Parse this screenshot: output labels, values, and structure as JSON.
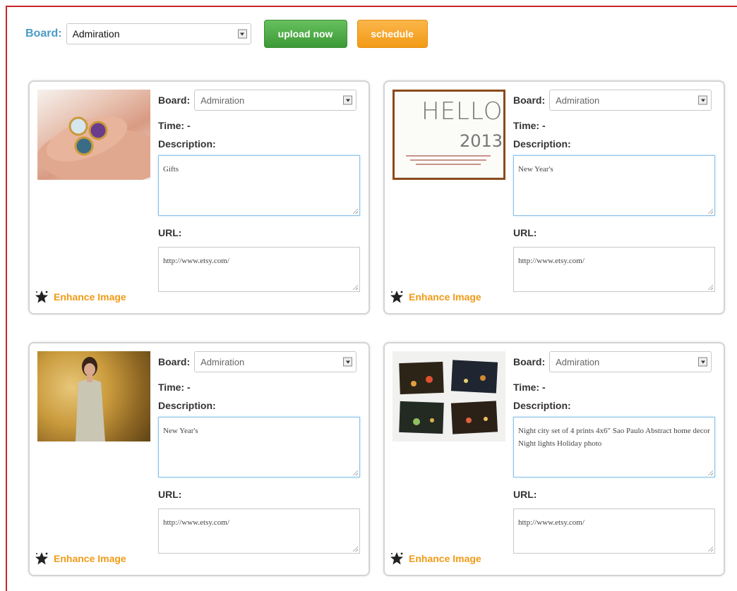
{
  "toolbar": {
    "board_label": "Board:",
    "board_value": "Admiration",
    "upload_label": "upload now",
    "schedule_label": "schedule"
  },
  "labels": {
    "board": "Board:",
    "time": "Time: -",
    "description": "Description:",
    "url": "URL:",
    "enhance": "Enhance Image"
  },
  "cards": [
    {
      "board": "Admiration",
      "description": "Gifts",
      "url": "http://www.etsy.com/"
    },
    {
      "board": "Admiration",
      "description": "New Year's",
      "url": "http://www.etsy.com/",
      "image_text": {
        "line1": "HELLO",
        "line2": "2013"
      }
    },
    {
      "board": "Admiration",
      "description": "New Year's",
      "url": "http://www.etsy.com/"
    },
    {
      "board": "Admiration",
      "description": "Night city set of 4 prints 4x6\" Sao Paulo Abstract home decor Night lights Holiday photo",
      "url": "http://www.etsy.com/"
    }
  ],
  "colors": {
    "accent_blue": "#4a9bc4",
    "upload_green": "#4aa842",
    "schedule_orange": "#f5a328",
    "enhance_orange": "#f29a16",
    "frame_red": "#c8262a"
  },
  "icons": [
    "chevron-down-icon",
    "star-icon"
  ]
}
